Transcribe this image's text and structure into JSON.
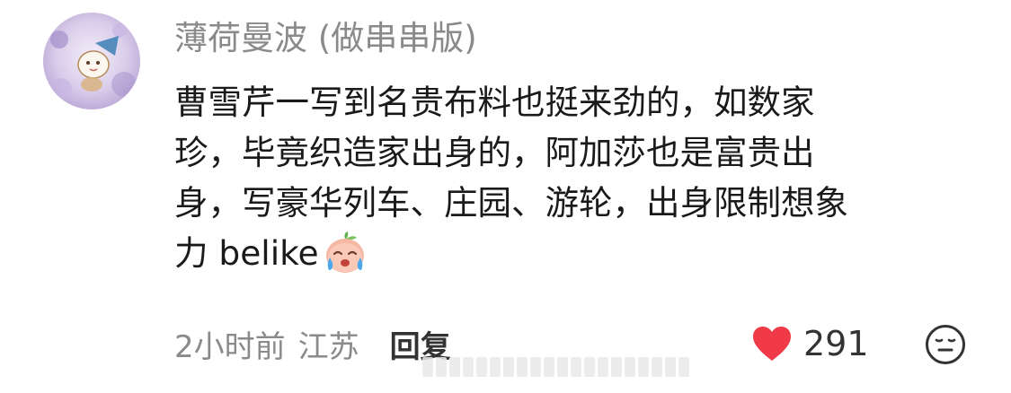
{
  "comment": {
    "username": "薄荷曼波 (做串串版)",
    "text_lines": [
      "曹雪芹一写到名贵布料也挺来劲的，如数家",
      "珍，毕竟织造家出身的，阿加莎也是富贵出",
      "身，写豪华列车、庄园、游轮，出身限制想象",
      "力 belike"
    ],
    "emoji_name": "crying-peach-emoji",
    "time": "2小时前",
    "location": "江苏",
    "reply_label": "回复",
    "likes": "291"
  },
  "icons": {
    "like": "heart-icon",
    "reaction": "neutral-face-icon"
  },
  "colors": {
    "heart": "#f03a47",
    "meta_text": "#8a8a8a",
    "body_text": "#1a1a1a"
  }
}
